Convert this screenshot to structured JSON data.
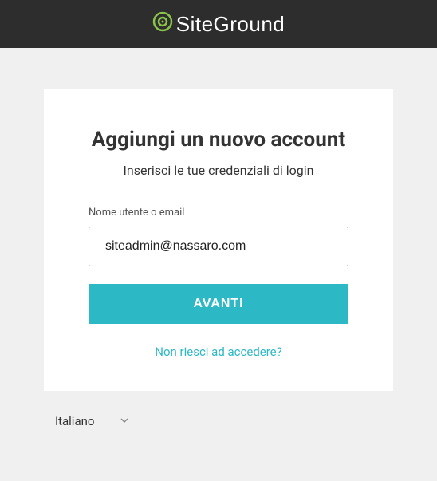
{
  "header": {
    "brand": "SiteGround"
  },
  "card": {
    "title": "Aggiungi un nuovo account",
    "subtitle": "Inserisci le tue credenziali di login",
    "username_label": "Nome utente o email",
    "username_value": "siteadmin@nassaro.com",
    "submit_label": "AVANTI",
    "help_link": "Non riesci ad accedere?"
  },
  "language": {
    "selected": "Italiano"
  }
}
